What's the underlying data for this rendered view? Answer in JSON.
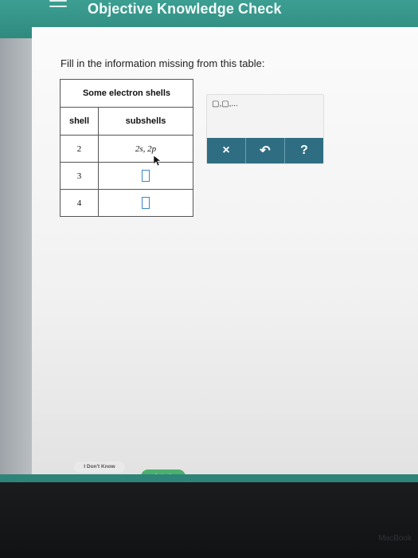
{
  "header": {
    "title": "Objective Knowledge Check"
  },
  "question": {
    "prompt": "Fill in the information missing from this table:"
  },
  "table": {
    "caption": "Some electron shells",
    "columns": [
      "shell",
      "subshells"
    ],
    "rows": [
      {
        "shell": "2",
        "subshells": "2s, 2p"
      },
      {
        "shell": "3",
        "subshells": ""
      },
      {
        "shell": "4",
        "subshells": ""
      }
    ]
  },
  "palette": {
    "template_label": "▢,▢,...",
    "buttons": {
      "clear": "×",
      "undo": "↶",
      "help": "?"
    }
  },
  "footer": {
    "dont_know": "I Don't Know",
    "submit": "Submit"
  },
  "device": {
    "brand": "MacBook"
  }
}
